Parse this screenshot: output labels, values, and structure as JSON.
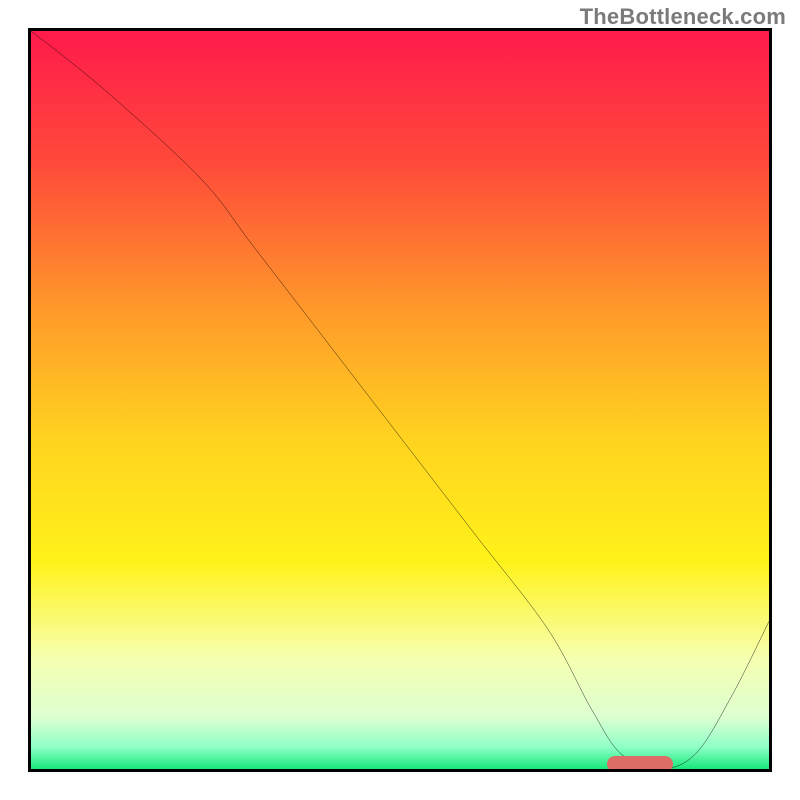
{
  "watermark": "TheBottleneck.com",
  "colors": {
    "frame": "#000000",
    "curve": "#000000",
    "marker": "#dd6b66"
  },
  "chart_data": {
    "type": "line",
    "title": "",
    "xlabel": "",
    "ylabel": "",
    "xlim": [
      0,
      100
    ],
    "ylim": [
      0,
      100
    ],
    "gradient_stops": [
      {
        "pct": 0,
        "color": "#ff1a4b"
      },
      {
        "pct": 18,
        "color": "#ff4a3a"
      },
      {
        "pct": 38,
        "color": "#ff9a2a"
      },
      {
        "pct": 55,
        "color": "#ffd21f"
      },
      {
        "pct": 72,
        "color": "#fff21a"
      },
      {
        "pct": 85,
        "color": "#f6ffb0"
      },
      {
        "pct": 93,
        "color": "#dcffd0"
      },
      {
        "pct": 97,
        "color": "#8fffc8"
      },
      {
        "pct": 100,
        "color": "#17e87a"
      }
    ],
    "series": [
      {
        "name": "bottleneck-curve",
        "x": [
          0,
          10,
          23,
          30,
          40,
          50,
          60,
          70,
          76,
          80,
          85,
          90,
          95,
          100
        ],
        "y": [
          100,
          92,
          80,
          71,
          58,
          45,
          32,
          19,
          8,
          2,
          0,
          2,
          10,
          20
        ]
      }
    ],
    "optimal_range": {
      "x_start": 78,
      "x_end": 87
    }
  }
}
